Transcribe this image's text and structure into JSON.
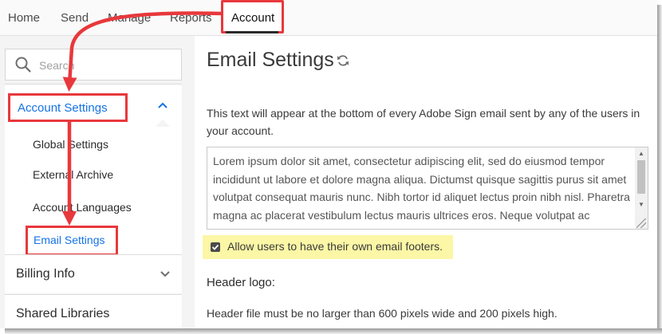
{
  "nav": {
    "items": [
      "Home",
      "Send",
      "Manage",
      "Reports"
    ],
    "active": "Account"
  },
  "sidebar": {
    "search_placeholder": "Search",
    "account_settings": {
      "label": "Account Settings",
      "items": [
        "Global Settings",
        "External Archive",
        "Account Languages"
      ],
      "active_item": "Email Settings"
    },
    "sections": [
      "Billing Info",
      "Shared Libraries"
    ]
  },
  "main": {
    "title": "Email Settings",
    "description": "This text will appear at the bottom of every Adobe Sign email sent by any of the users in your account.",
    "footer_text": "Lorem ipsum dolor sit amet, consectetur adipiscing elit, sed do eiusmod tempor incididunt ut labore et dolore magna aliqua. Dictumst quisque sagittis purus sit amet volutpat consequat mauris nunc. Nibh tortor id aliquet lectus proin nibh nisl. Pharetra magna ac placerat vestibulum lectus mauris ultrices eros. Neque volutpat ac tincidunt vitae semper quis lectus nulla at volutpat.",
    "allow_footers_label": "Allow users to have their own email footers.",
    "allow_footers_checked": true,
    "header_logo_label": "Header logo:",
    "header_logo_note": "Header file must be no larger than 600 pixels wide and 200 pixels high."
  },
  "colors": {
    "accent_blue": "#1473e6",
    "annotation_red": "#e8383c",
    "highlight_yellow": "#fbf7a6"
  },
  "icons": [
    "search-icon",
    "chevron-up-icon",
    "chevron-down-icon",
    "refresh-icon",
    "checkmark-icon"
  ]
}
